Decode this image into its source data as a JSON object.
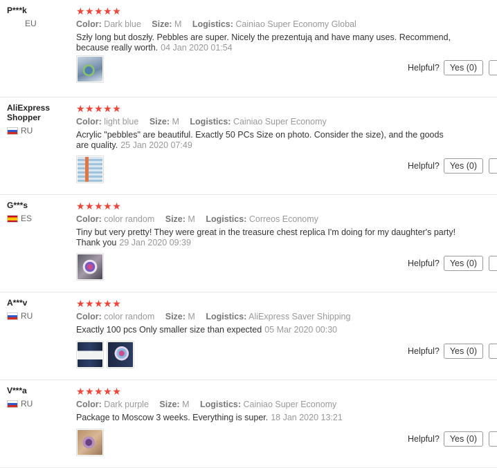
{
  "helpful_label": "Helpful?",
  "labels": {
    "color": "Color:",
    "size": "Size:",
    "logistics": "Logistics:"
  },
  "stars": "★★★★★",
  "star_color": "#f44336",
  "reviews": [
    {
      "user": "P***k",
      "country": "EU",
      "flag": "none",
      "rating": 5,
      "color": "Dark blue",
      "size": "M",
      "logistics": "Cainiao Super Economy Global",
      "text": "Szły long but doszły. Pebbles are super. Nicely the prezentują and have many uses. Recommend, because really worth.",
      "date": "04 Jan 2020 01:54",
      "yes_label": "Yes (0)",
      "photos": [
        "blue-pebbles-bag-photo"
      ]
    },
    {
      "user": "AliExpress Shopper",
      "country": "RU",
      "flag": "ru",
      "rating": 5,
      "color": "light blue",
      "size": "M",
      "logistics": "Cainiao Super Economy",
      "text": "Acrylic \"pebbles\" are beautiful. Exactly 50 PCs Size on photo. Consider the size), and the goods are quality.",
      "date": "25 Jan 2020 07:49",
      "yes_label": "Yes (0)",
      "photos": [
        "pebbles-with-tape-measure-photo"
      ]
    },
    {
      "user": "G***s",
      "country": "ES",
      "flag": "es",
      "rating": 5,
      "color": "color random",
      "size": "M",
      "logistics": "Correos Economy",
      "text": "Tiny but very pretty! They were great in the treasure chest replica I'm doing for my daughter's party! Thank you",
      "date": "29 Jan 2020 09:39",
      "yes_label": "Yes (0)",
      "photos": [
        "colorful-pebbles-bag-photo"
      ]
    },
    {
      "user": "A***v",
      "country": "RU",
      "flag": "ru",
      "rating": 5,
      "color": "color random",
      "size": "M",
      "logistics": "AliExpress Saver Shipping",
      "text": "Exactly 100 pcs Only smaller size than expected",
      "date": "05 Mar 2020 00:30",
      "yes_label": "Yes (0)",
      "photos": [
        "package-on-dark-cloth-photo",
        "pebbles-in-hand-photo"
      ]
    },
    {
      "user": "V***a",
      "country": "RU",
      "flag": "ru",
      "rating": 5,
      "color": "Dark purple",
      "size": "M",
      "logistics": "Cainiao Super Economy",
      "text": "Package to Moscow 3 weeks. Everything is super.",
      "date": "18 Jan 2020 13:21",
      "yes_label": "Yes (0)",
      "photos": [
        "purple-pebbles-photo"
      ]
    }
  ]
}
